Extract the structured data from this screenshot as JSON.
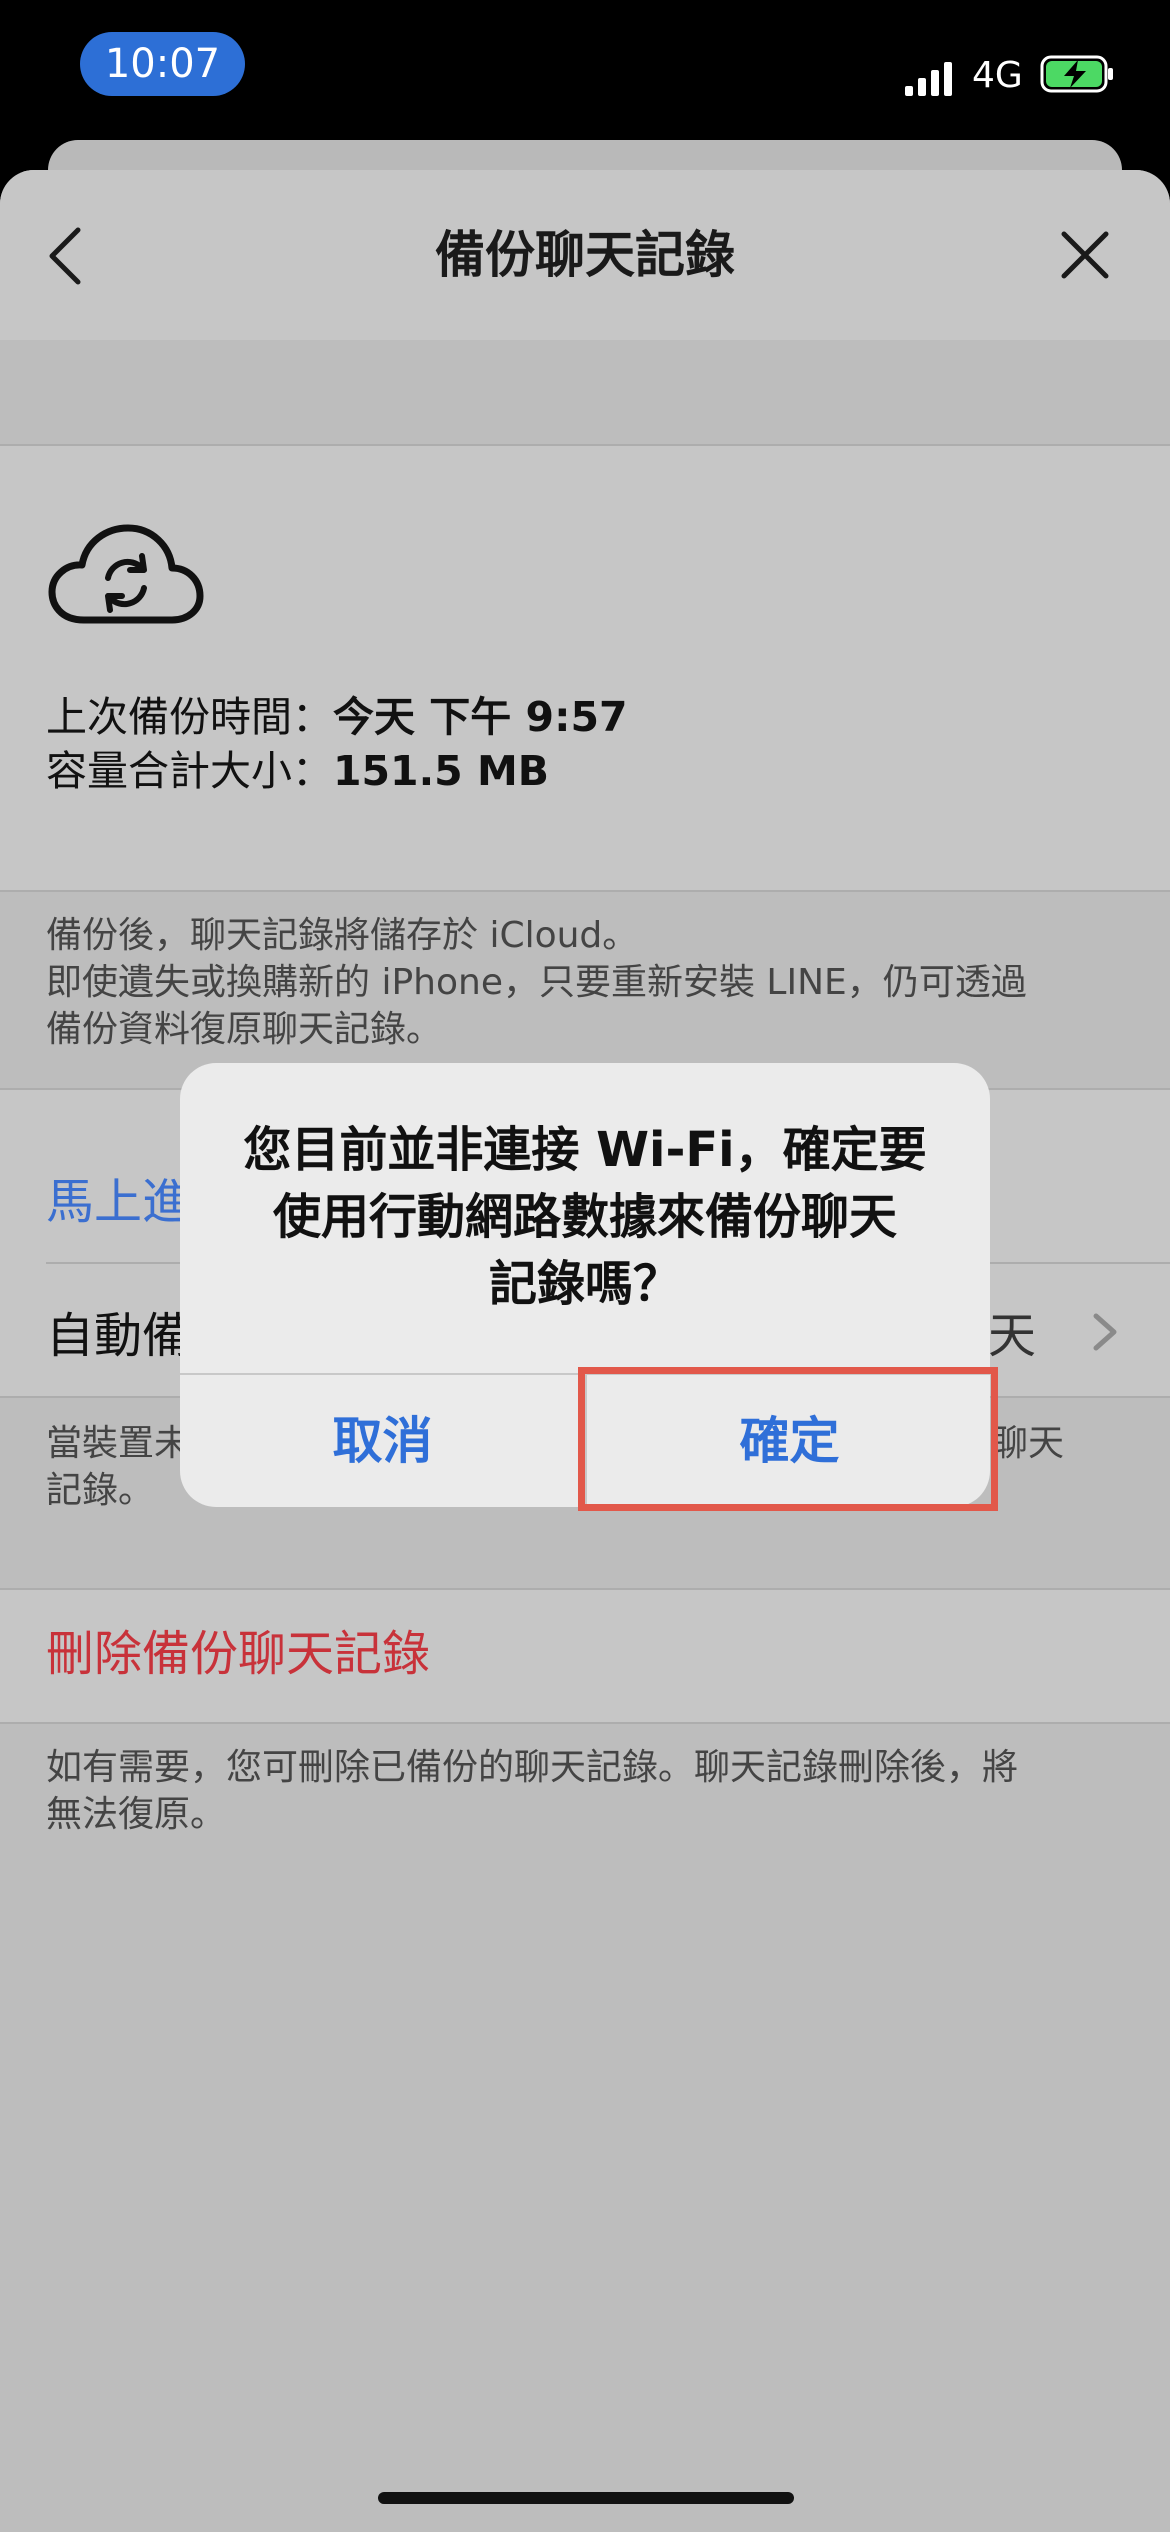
{
  "status": {
    "time": "10:07",
    "network": "4G",
    "icons": [
      "signal-icon",
      "battery-charging-icon"
    ]
  },
  "nav": {
    "title": "備份聊天記錄",
    "back_icon": "chevron-left-icon",
    "close_icon": "close-icon"
  },
  "backup_info": {
    "icon": "cloud-sync-icon",
    "last_backup_label": "上次備份時間：",
    "last_backup_value": "今天 下午 9:57",
    "size_label": "容量合計大小：",
    "size_value": "151.5 MB"
  },
  "description": {
    "line1": "備份後，聊天記錄將儲存於 iCloud。",
    "line2": "即使遺失或換購新的 iPhone，只要重新安裝 LINE，仍可透過",
    "line3": "備份資料復原聊天記錄。"
  },
  "rows": {
    "backup_now": "馬上進",
    "auto_backup": "自動備",
    "auto_backup_value": "天",
    "auto_desc_line1_left": "當裝置未",
    "auto_desc_line1_right": "聊天",
    "auto_desc_line2": "記錄。"
  },
  "delete": {
    "label": "刪除備份聊天記錄",
    "desc_line1": "如有需要，您可刪除已備份的聊天記錄。聊天記錄刪除後，將",
    "desc_line2": "無法復原。"
  },
  "dialog": {
    "line1": "您目前並非連接 Wi-Fi，確定要",
    "line2": "使用行動網路數據來備份聊天",
    "line3": "記錄嗎？",
    "cancel": "取消",
    "confirm": "確定"
  },
  "colors": {
    "accent_blue": "#2f6fd8",
    "danger_red": "#c8323a",
    "highlight": "#e2584a",
    "time_pill": "#2d6fd6"
  }
}
